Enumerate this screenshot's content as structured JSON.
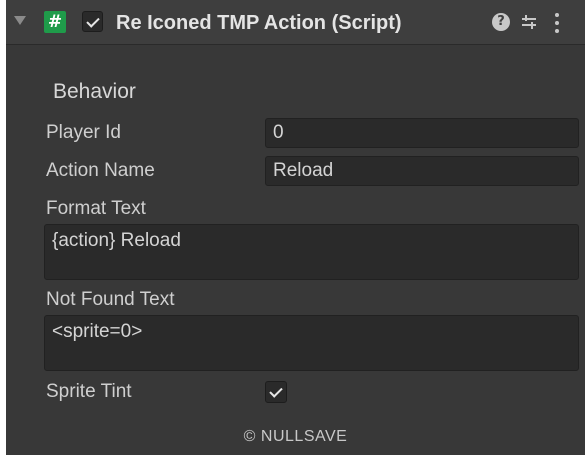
{
  "header": {
    "title": "Re Iconed TMP Action (Script)",
    "script_icon_glyph": "#",
    "enabled": true,
    "icons": [
      "foldout-arrow-icon",
      "script-icon",
      "enable-checkbox",
      "help-icon",
      "preset-icon",
      "context-menu-icon"
    ]
  },
  "section": {
    "label": "Behavior"
  },
  "fields": {
    "player_id": {
      "label": "Player Id",
      "value": "0"
    },
    "action_name": {
      "label": "Action Name",
      "value": "Reload"
    },
    "format_text": {
      "label": "Format Text",
      "value": "{action} Reload"
    },
    "not_found_text": {
      "label": "Not Found Text",
      "value": "<sprite=0>"
    },
    "sprite_tint": {
      "label": "Sprite Tint",
      "checked": true
    }
  },
  "footer": {
    "text": "© NULLSAVE"
  },
  "colors": {
    "panel_bg": "#383838",
    "header_bg": "#3e3e3e",
    "input_bg": "#2a2a2a",
    "script_icon": "#1f9b4a",
    "text": "#d2d2d2"
  }
}
